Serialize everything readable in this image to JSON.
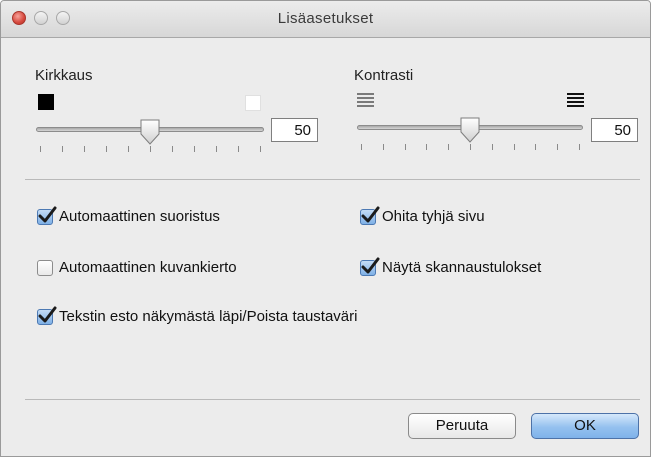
{
  "window": {
    "title": "Lisäasetukset"
  },
  "brightness": {
    "label": "Kirkkaus",
    "value": "50",
    "level": 0.5,
    "min_icon": "black-square-icon",
    "max_icon": "white-square-icon"
  },
  "contrast": {
    "label": "Kontrasti",
    "value": "50",
    "level": 0.5,
    "min_icon": "low-contrast-lines-icon",
    "max_icon": "high-contrast-lines-icon"
  },
  "options": {
    "auto_deskew": {
      "label": "Automaattinen suoristus",
      "checked": true
    },
    "skip_blank": {
      "label": "Ohita tyhjä sivu",
      "checked": true
    },
    "auto_rotate": {
      "label": "Automaattinen kuvankierto",
      "checked": false
    },
    "show_results": {
      "label": "Näytä skannaustulokset",
      "checked": true
    },
    "bleed_through": {
      "label": "Tekstin esto näkymästä läpi/Poista taustaväri",
      "checked": true
    }
  },
  "buttons": {
    "cancel": "Peruuta",
    "ok": "OK"
  },
  "colors": {
    "default_button": "#95c1ef",
    "checkbox_checked": "#7fb0e6",
    "checkmark": "#1b1b1b"
  }
}
